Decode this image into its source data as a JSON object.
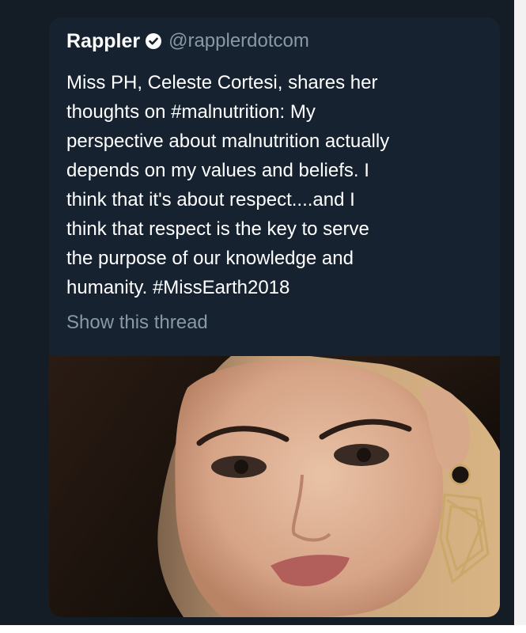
{
  "tweet": {
    "author_name": "Rappler",
    "handle": "@rapplerdotcom",
    "verified_icon": "verified-badge-icon",
    "text_lines": [
      "Miss PH, Celeste Cortesi, shares her",
      "thoughts on #malnutrition: My",
      "perspective about malnutrition actually",
      "depends on my values and beliefs. I",
      "think that it's about respect....and I",
      "think that respect is the key to serve",
      "the purpose of our knowledge and",
      "humanity. #MissEarth2018"
    ],
    "show_thread_label": "Show this thread",
    "media_description": "portrait-photo"
  },
  "colors": {
    "background": "#141d26",
    "card": "#162230",
    "text": "#ffffff",
    "secondary_text": "#8899a6"
  }
}
